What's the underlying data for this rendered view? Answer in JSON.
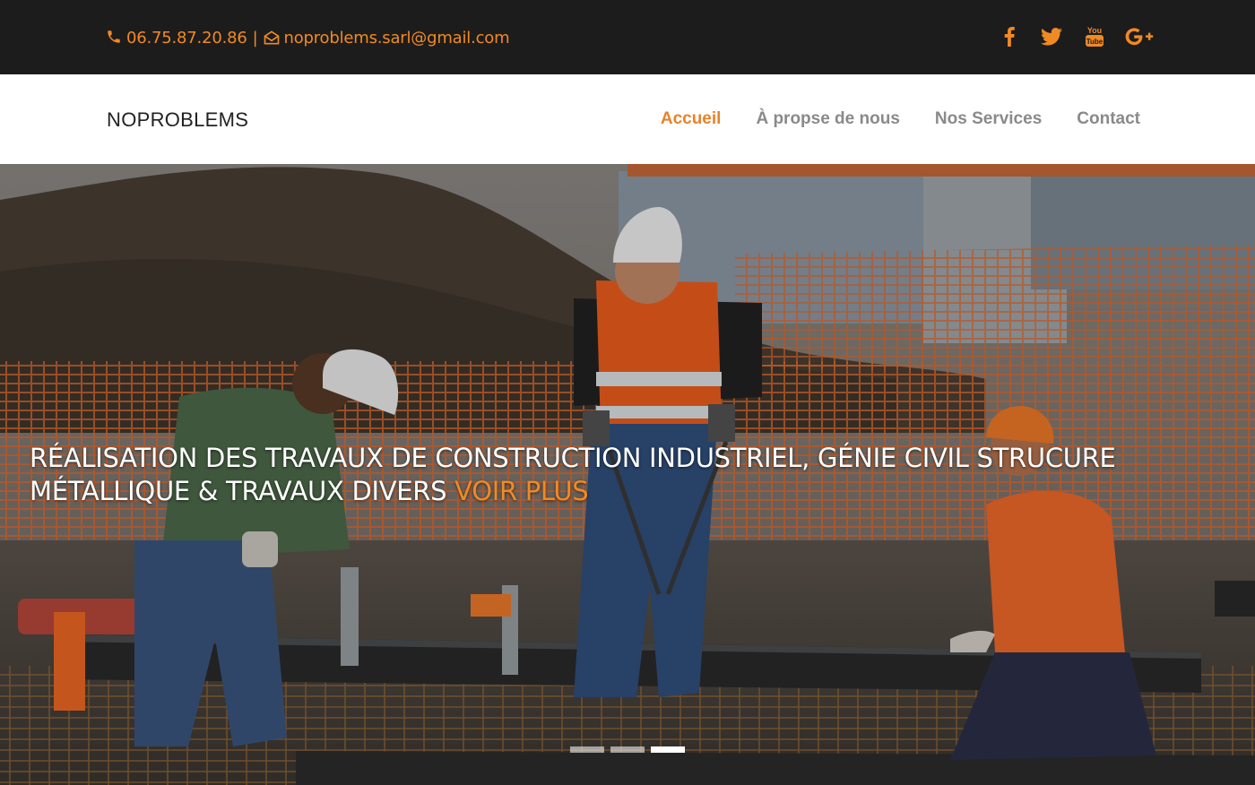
{
  "topbar": {
    "phone": "06.75.87.20.86",
    "separator": "|",
    "email": "noproblems.sarl@gmail.com",
    "phone_icon": "phone-icon",
    "email_icon": "envelope-open-icon",
    "social": [
      {
        "name": "facebook-icon"
      },
      {
        "name": "twitter-icon"
      },
      {
        "name": "youtube-icon",
        "label": "You Tube"
      },
      {
        "name": "google-plus-icon",
        "label": "G+"
      }
    ]
  },
  "nav": {
    "brand": "NOPROBLEMS",
    "items": [
      {
        "label": "Accueil",
        "active": true
      },
      {
        "label": "À propse de nous",
        "active": false
      },
      {
        "label": "Nos Services",
        "active": false
      },
      {
        "label": "Contact",
        "active": false
      }
    ]
  },
  "hero": {
    "headline": "RÉALISATION DES TRAVAUX DE CONSTRUCTION INDUSTRIEL, GÉNIE CIVIL STRUCURE MÉTALLIQUE & TRAVAUX DIVERS",
    "cta": "VOIR PLUS",
    "slides_total": 3,
    "active_slide": 3
  },
  "colors": {
    "accent": "#f08a24",
    "topbar_bg": "#1d1c1c",
    "nav_text": "#8a8a8a"
  }
}
